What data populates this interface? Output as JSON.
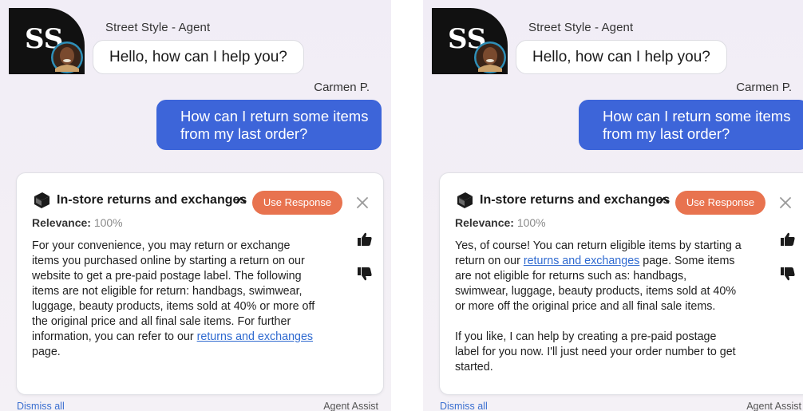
{
  "colors": {
    "accent_blue": "#3d65d9",
    "use_response_orange": "#e8734f",
    "link_blue": "#2f6ad0",
    "avatar_black": "#111111"
  },
  "left": {
    "agent_name": "Street Style - Agent",
    "agent_message": "Hello, how can I help you?",
    "customer_name": "Carmen P.",
    "customer_message": "How can I return some items from my last order?",
    "card": {
      "title": "In-store returns and exchanges",
      "use_response_label": "Use Response",
      "relevance_label": "Relevance:",
      "relevance_value": "100%",
      "body_text": "For your convenience, you may return or exchange items you purchased online by starting a return on our website to get a pre-paid postage label. The following items are not eligible for return: handbags, swimwear, luggage, beauty products, items sold at 40% or more off the original price and all final sale items. For further information, you can refer to our ",
      "body_link": "returns and exchanges",
      "body_after": " page."
    },
    "dismiss_all": "Dismiss all",
    "agent_assist": "Agent Assist"
  },
  "right": {
    "agent_name": "Street Style - Agent",
    "agent_message": "Hello, how can I help you?",
    "customer_name": "Carmen P.",
    "customer_message": "How can I return some items from my last order?",
    "card": {
      "title": "In-store returns and exchanges",
      "use_response_label": "Use Response",
      "relevance_label": "Relevance:",
      "relevance_value": "100%",
      "body_before": "Yes, of course! You can return eligible items by starting a return on our ",
      "body_link": "returns and exchanges",
      "body_after": " page. Some items are not eligible for returns such as: handbags, swimwear, luggage, beauty products, items sold at 40% or more off the original price and all final sale items.",
      "body_para2": "If you like, I can help by creating a pre-paid postage label for you now. I'll just need your order number to get started."
    },
    "dismiss_all": "Dismiss all",
    "agent_assist": "Agent Assist"
  },
  "icons": {
    "avatar": "street-style-logo-with-agent-photo",
    "book": "book-icon",
    "chevron": "chevron-up-icon",
    "close": "close-icon",
    "thumbs_up": "thumbs-up-icon",
    "thumbs_down": "thumbs-down-icon"
  }
}
